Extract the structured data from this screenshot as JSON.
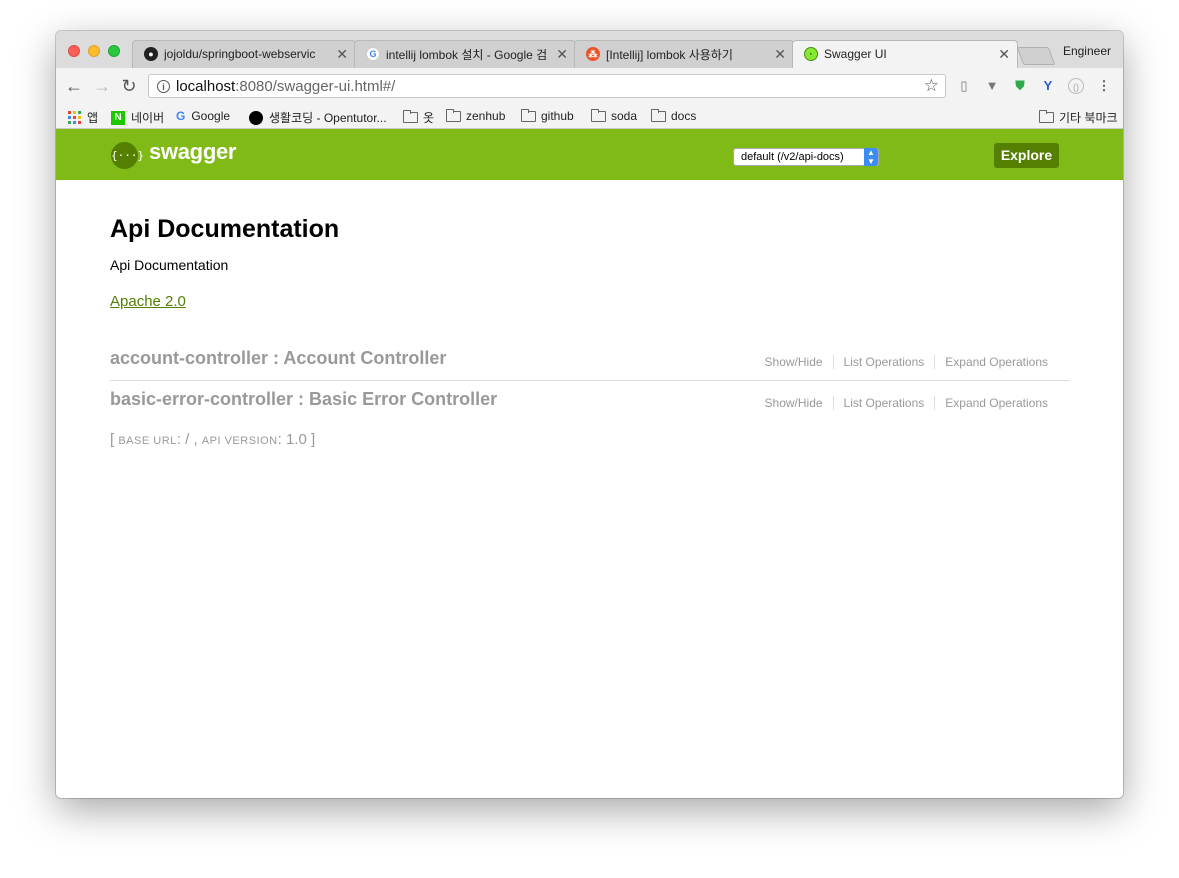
{
  "browser": {
    "tabs": [
      {
        "title": "jojoldu/springboot-webservic",
        "favicon": "github-icon",
        "active": false
      },
      {
        "title": "intellij lombok 설치 - Google 검",
        "favicon": "google-icon",
        "active": false
      },
      {
        "title": "[Intellij] lombok 사용하기",
        "favicon": "tistory-icon",
        "active": false
      },
      {
        "title": "Swagger UI",
        "favicon": "swagger-favicon-icon",
        "active": true
      }
    ],
    "profile_name": "Engineer",
    "url_host": "localhost",
    "url_path": ":8080/swagger-ui.html#/",
    "bookmarks": [
      {
        "label": "앱",
        "icon": "apps-icon"
      },
      {
        "label": "네이버",
        "icon": "naver-icon"
      },
      {
        "label": "Google",
        "icon": "google-icon"
      },
      {
        "label": "생활코딩 - Opentutor...",
        "icon": "circle-icon"
      },
      {
        "label": "옷",
        "icon": "folder-icon"
      },
      {
        "label": "zenhub",
        "icon": "folder-icon"
      },
      {
        "label": "github",
        "icon": "folder-icon"
      },
      {
        "label": "soda",
        "icon": "folder-icon"
      },
      {
        "label": "docs",
        "icon": "folder-icon"
      }
    ],
    "other_bookmarks": "기타 북마크"
  },
  "swagger": {
    "logo_text": "swagger",
    "logo_symbol": "{···}",
    "spec_select": "default (/v2/api-docs)",
    "explore_label": "Explore",
    "accent_color": "#7fba17",
    "dark_accent": "#547f00"
  },
  "api": {
    "title": "Api Documentation",
    "description": "Api Documentation",
    "license": "Apache 2.0",
    "resources": [
      {
        "name": "account-controller : Account Controller",
        "show_hide": "Show/Hide",
        "list_ops": "List Operations",
        "expand_ops": "Expand Operations"
      },
      {
        "name": "basic-error-controller : Basic Error Controller",
        "show_hide": "Show/Hide",
        "list_ops": "List Operations",
        "expand_ops": "Expand Operations"
      }
    ],
    "footer": {
      "open_bracket": "[",
      "base_url_label": "base url",
      "base_url": "/",
      "api_version_label": "api version",
      "api_version": "1.0",
      "close_bracket": "]"
    }
  }
}
